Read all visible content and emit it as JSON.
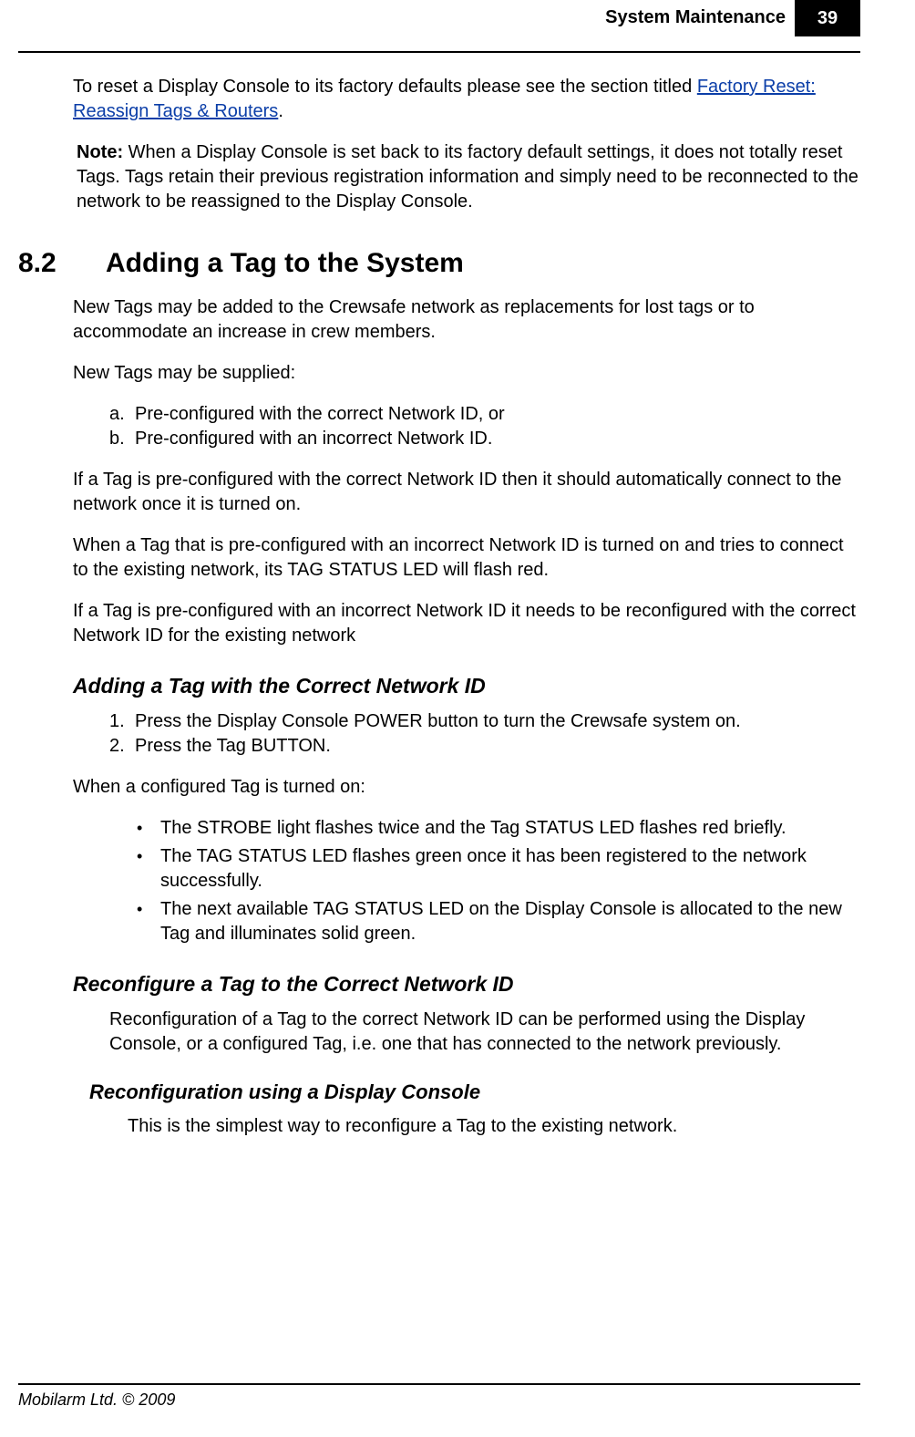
{
  "header": {
    "title": "System Maintenance",
    "page_number": "39"
  },
  "intro": {
    "sentence_pre": "To reset a Display Console to its factory defaults please see the section titled ",
    "link_text": "Factory Reset: Reassign Tags & Routers",
    "sentence_post": "."
  },
  "note": {
    "label": "Note:",
    "text": " When a Display Console is set back to its factory default settings, it does not totally reset Tags. Tags retain their previous registration information and simply need to be reconnected to the network to be reassigned to the Display Console."
  },
  "section": {
    "number": "8.2",
    "title": "Adding a Tag to the System",
    "p1": "New Tags may be added to the Crewsafe network as replacements for lost tags or to accommodate an increase in crew members.",
    "p2": "New Tags may be supplied:",
    "letters": [
      {
        "marker": "a.",
        "text": "Pre-configured with the correct Network ID, or"
      },
      {
        "marker": "b.",
        "text": "Pre-configured with an incorrect Network ID."
      }
    ],
    "p3": "If a Tag is pre-configured with the correct Network ID then it should automatically connect to the network once it is turned on.",
    "p4": "When a Tag that is pre-configured with an incorrect Network ID is turned on and tries to connect to the existing network, its TAG STATUS LED will flash red.",
    "p5": "If a Tag is pre-configured with an incorrect Network ID it needs to be reconfigured with the correct Network ID for the existing network"
  },
  "sub1": {
    "heading": "Adding a Tag with the Correct Network ID",
    "steps": [
      {
        "marker": "1.",
        "text": "Press the Display Console POWER button to turn the Crewsafe system on."
      },
      {
        "marker": "2.",
        "text": "Press the Tag BUTTON."
      }
    ],
    "p1": "When a configured Tag is turned on:",
    "bullets": [
      "The STROBE light flashes twice and the Tag STATUS LED flashes red briefly.",
      "The TAG STATUS LED flashes green once it has been registered to the network successfully.",
      "The next available TAG STATUS LED on the Display Console is allocated to the new Tag and illuminates solid green."
    ]
  },
  "sub2": {
    "heading": "Reconfigure a Tag to the Correct Network ID",
    "p1": "Reconfiguration of a Tag to the correct Network ID can be performed using the Display Console, or a configured Tag, i.e. one that has connected to the network previously."
  },
  "sub3": {
    "heading": "Reconfiguration using a Display Console",
    "p1": "This is the simplest way to reconfigure a Tag to the existing network."
  },
  "footer": "Mobilarm Ltd. © 2009"
}
